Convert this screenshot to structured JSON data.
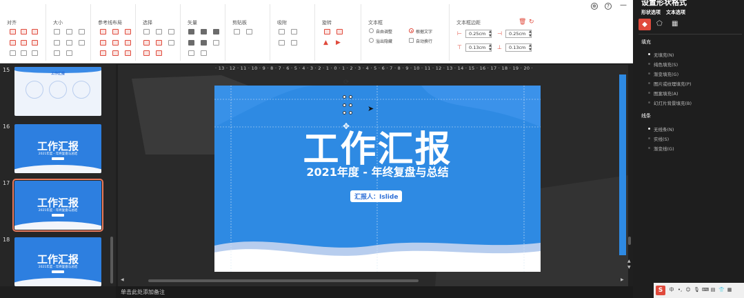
{
  "ribbon": {
    "groups": {
      "align": "对齐",
      "size": "大小",
      "guides": "参考线布局",
      "select": "选择",
      "vector": "矢量",
      "clipboard": "剪贴板",
      "snap": "吸附",
      "rotate": "旋转",
      "textbox": "文本框",
      "margins": "文本框边距"
    },
    "textbox_options": [
      "自由调整",
      "根据文字",
      "溢出隐藏",
      "自动换行"
    ],
    "margins": {
      "left": "0.25cm",
      "right": "0.25cm",
      "top": "0.13cm",
      "bottom": "0.13cm"
    }
  },
  "panel": {
    "title": "设置形状格式",
    "tabs": [
      "形状选项",
      "文本选项"
    ],
    "fill_header": "填充",
    "fill_options": [
      "无填充(N)",
      "纯色填充(S)",
      "渐变填充(G)",
      "图片或纹理填充(P)",
      "图案填充(A)",
      "幻灯片背景填充(B)"
    ],
    "line_header": "线条",
    "line_options": [
      "无线条(N)",
      "实线(S)",
      "渐变线(G)"
    ]
  },
  "thumbnails": [
    {
      "num": "15",
      "title": "工作汇报",
      "subtitle": "",
      "selected": false
    },
    {
      "num": "16",
      "title": "工作汇报",
      "subtitle": "2021年度 - 年终复盘与总结",
      "selected": false
    },
    {
      "num": "17",
      "title": "工作汇报",
      "subtitle": "2021年度 - 年终复盘与总结",
      "selected": true
    },
    {
      "num": "18",
      "title": "工作汇报",
      "subtitle": "2021年度 - 年终复盘与总结",
      "selected": false
    }
  ],
  "slide": {
    "title": "工作汇报",
    "subtitle": "2021年度 - 年终复盘与总结",
    "reporter": "汇报人：Islide"
  },
  "ruler_h": "· 13 · 12 · 11 · 10 · 9 · 8 · 7 · 6 · 5 · 4 · 3 · 2 · 1 · 0 · 1 · 2 · 3 · 4 · 5 · 6 · 7 · 8 · 9 · 10 · 11 · 12 · 13 · 14 · 15 · 16 · 17 · 18 · 19 · 20 ·",
  "notes": "单击此处添加备注",
  "colors": {
    "accent": "#e04a3c",
    "slide_blue": "#2e8ae3",
    "selected_thumb": "#e87a5d"
  }
}
